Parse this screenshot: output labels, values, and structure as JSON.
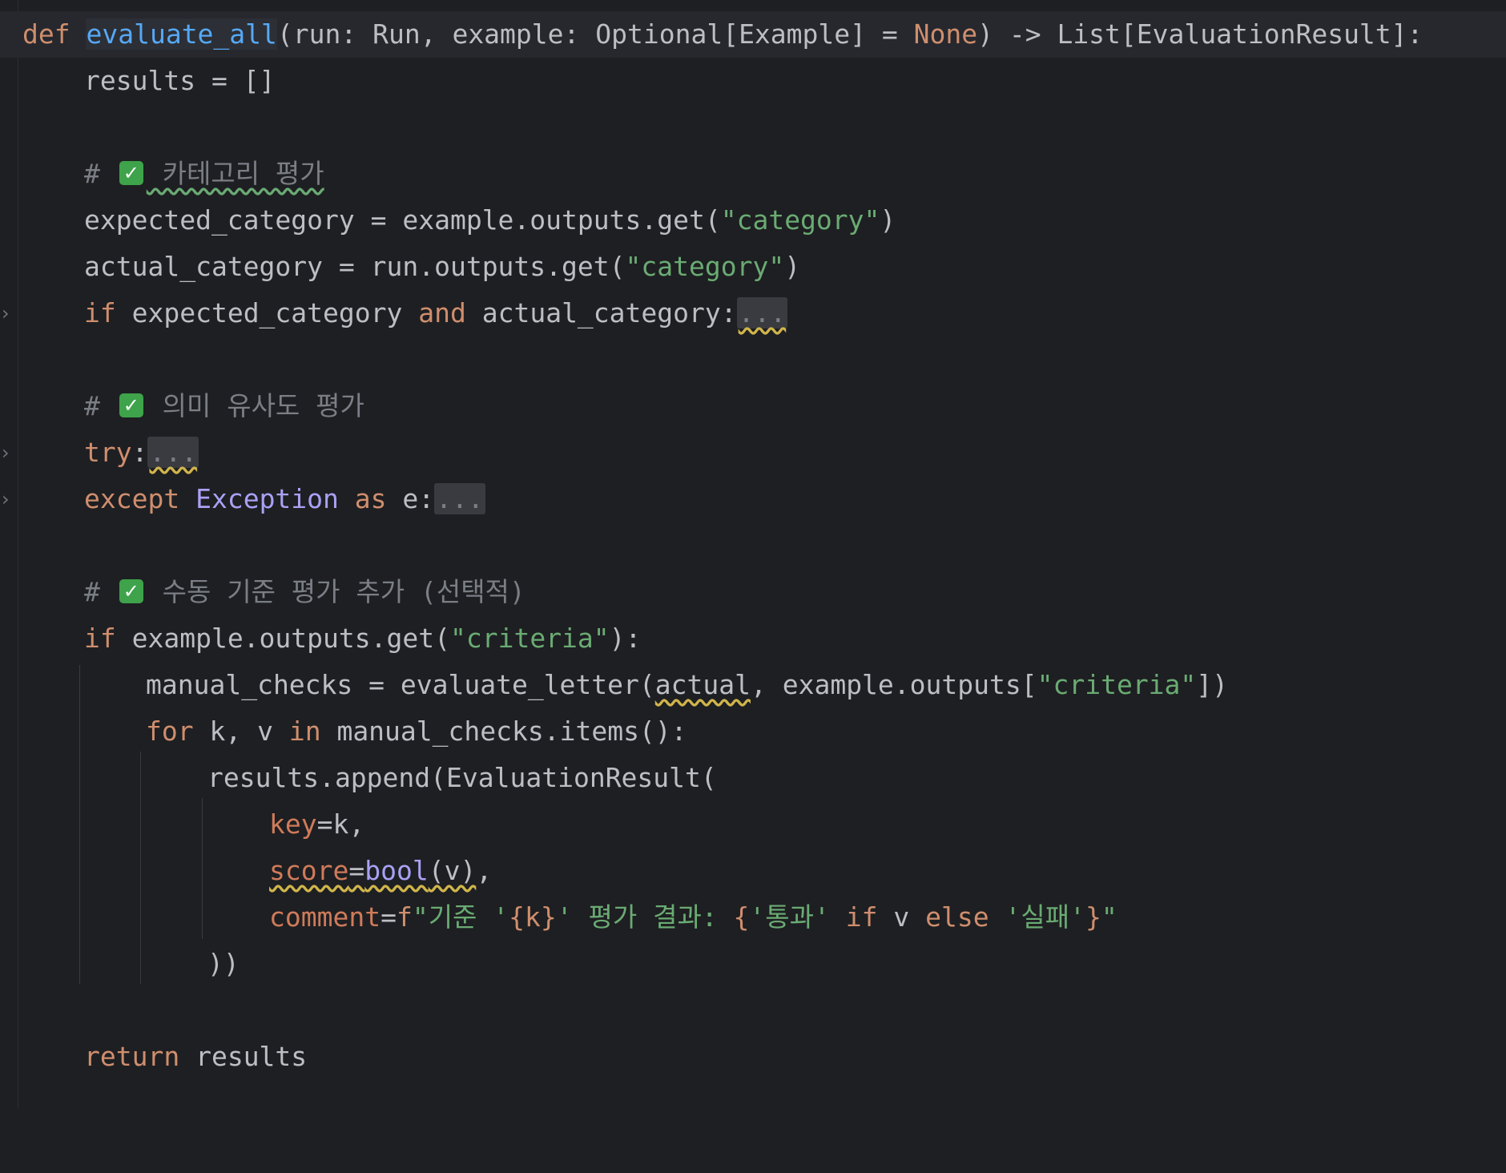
{
  "editor": {
    "lines": [
      {
        "id": "l1",
        "indent": 0,
        "text": "def evaluate_all(run: Run, example: Optional[Example] = None) -> List[EvaluationResult]:"
      },
      {
        "id": "l2",
        "indent": 1,
        "text": "results = []"
      },
      {
        "id": "l4",
        "indent": 1,
        "comment_prefix": "# ",
        "comment_text": " 카테고리 평가"
      },
      {
        "id": "l5",
        "indent": 1,
        "text": "expected_category = example.outputs.get(\"category\")"
      },
      {
        "id": "l6",
        "indent": 1,
        "text": "actual_category = run.outputs.get(\"category\")"
      },
      {
        "id": "l7",
        "indent": 1,
        "text": "if expected_category and actual_category:...",
        "folded": true
      },
      {
        "id": "l9",
        "indent": 1,
        "comment_prefix": "# ",
        "comment_text": " 의미 유사도 평가"
      },
      {
        "id": "l10",
        "indent": 1,
        "text": "try:...",
        "folded": true
      },
      {
        "id": "l11",
        "indent": 1,
        "text": "except Exception as e:...",
        "folded": true
      },
      {
        "id": "l13",
        "indent": 1,
        "comment_prefix": "# ",
        "comment_text": " 수동 기준 평가 추가 (선택적)"
      },
      {
        "id": "l14",
        "indent": 1,
        "text": "if example.outputs.get(\"criteria\"):"
      },
      {
        "id": "l15",
        "indent": 2,
        "text": "manual_checks = evaluate_letter(actual, example.outputs[\"criteria\"])"
      },
      {
        "id": "l16",
        "indent": 2,
        "text": "for k, v in manual_checks.items():"
      },
      {
        "id": "l17",
        "indent": 3,
        "text": "results.append(EvaluationResult("
      },
      {
        "id": "l18",
        "indent": 4,
        "text": "key=k,"
      },
      {
        "id": "l19",
        "indent": 4,
        "text": "score=bool(v),"
      },
      {
        "id": "l20",
        "indent": 4,
        "text": "comment=f\"기준 '{k}' 평가 결과: {'통과' if v else '실패'}\""
      },
      {
        "id": "l21",
        "indent": 3,
        "text": "))"
      },
      {
        "id": "l23",
        "indent": 1,
        "text": "return results"
      }
    ],
    "tokens": {
      "def": "def",
      "fn_name": "evaluate_all",
      "sig_a": "(run: Run, example: Optional[Example] = ",
      "none": "None",
      "sig_b": ") -> List[EvaluationResult]:",
      "results_init": "results = []",
      "c1_hash": "# ",
      "c1_text": " 카테고리 평가",
      "exp_a": "expected_category = example.outputs.get(",
      "exp_str": "\"category\"",
      "exp_b": ")",
      "act_a": "actual_category = run.outputs.get(",
      "act_str": "\"category\"",
      "act_b": ")",
      "if": "if",
      "cond_a": " expected_category ",
      "and": "and",
      "cond_b": " actual_category:",
      "ellipsis": "...",
      "c2_text": " 의미 유사도 평가",
      "try": "try",
      "colon": ":",
      "except": "except",
      "exception": "Exception",
      "as": "as",
      "e_colon": " e:",
      "c3_text": " 수동 기준 평가 추가 (선택적)",
      "crit_a": " example.outputs.get(",
      "crit_str": "\"criteria\"",
      "crit_b": "):",
      "mc_a": "manual_checks = evaluate_letter(",
      "actual": "actual",
      "mc_b": ", example.outputs[",
      "mc_str": "\"criteria\"",
      "mc_c": "])",
      "for": "for",
      "for_a": " k, v ",
      "in": "in",
      "for_b": " manual_checks.items():",
      "append": "results.append(EvaluationResult(",
      "key": "key",
      "key_val": "=k,",
      "score": "score",
      "eq": "=",
      "bool": "bool",
      "bool_arg": "(v)",
      "comma": ",",
      "comment": "comment",
      "fpref": "f",
      "fstr_a": "\"기준 '",
      "fbrace_k": "{k}",
      "fstr_b": "' 평가 결과: ",
      "fbrace_o": "{",
      "pass": "'통과'",
      "if2": " if ",
      "v": "v",
      "else": " else ",
      "fail": "'실패'",
      "fbrace_c": "}",
      "fstr_end": "\"",
      "close": "))",
      "return": "return",
      "results_ret": " results"
    }
  }
}
